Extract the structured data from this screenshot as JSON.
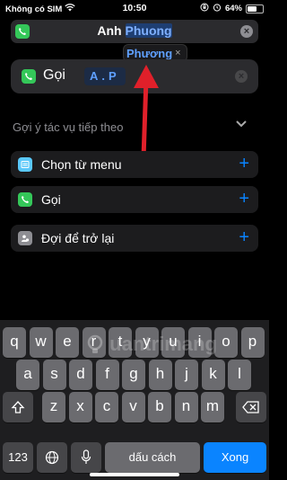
{
  "status_bar": {
    "carrier": "Không có SIM",
    "time": "10:50",
    "battery_percent": "64%",
    "battery_level": 0.64,
    "icons": [
      "wifi-icon",
      "orientation-lock-icon",
      "alarm-icon",
      "battery-icon"
    ]
  },
  "search": {
    "text_prefix": "Anh ",
    "text_highlight": "Phuong",
    "app_icon": "phone-icon"
  },
  "popup": {
    "chip_text": "Phương",
    "chip_close": "×"
  },
  "action": {
    "label": "Gọi",
    "param": "A.P",
    "app_icon": "phone-icon"
  },
  "suggestions": {
    "header": "Gợi ý tác vụ tiếp theo",
    "items": [
      {
        "label": "Chọn từ menu",
        "icon": "menu-icon",
        "color": "#5ac8fa"
      },
      {
        "label": "Gọi",
        "icon": "phone-icon",
        "color": "#34c759"
      },
      {
        "label": "Đợi để trở lại",
        "icon": "person-icon",
        "color": "#8e8e93"
      }
    ],
    "add_symbol": "+"
  },
  "keyboard": {
    "row1": [
      "q",
      "w",
      "e",
      "r",
      "t",
      "y",
      "u",
      "i",
      "o",
      "p"
    ],
    "row2": [
      "a",
      "s",
      "d",
      "f",
      "g",
      "h",
      "j",
      "k",
      "l"
    ],
    "row3": [
      "z",
      "x",
      "c",
      "v",
      "b",
      "n",
      "m"
    ],
    "numbers_key": "123",
    "space_label": "dấu cách",
    "done_label": "Xong",
    "icons": [
      "shift-icon",
      "backspace-icon",
      "globe-icon",
      "microphone-icon"
    ]
  },
  "watermark": {
    "text": "uantrimang",
    "icon": "lightbulb-icon"
  },
  "annotation": {
    "color": "#e0202a",
    "type": "arrow"
  }
}
